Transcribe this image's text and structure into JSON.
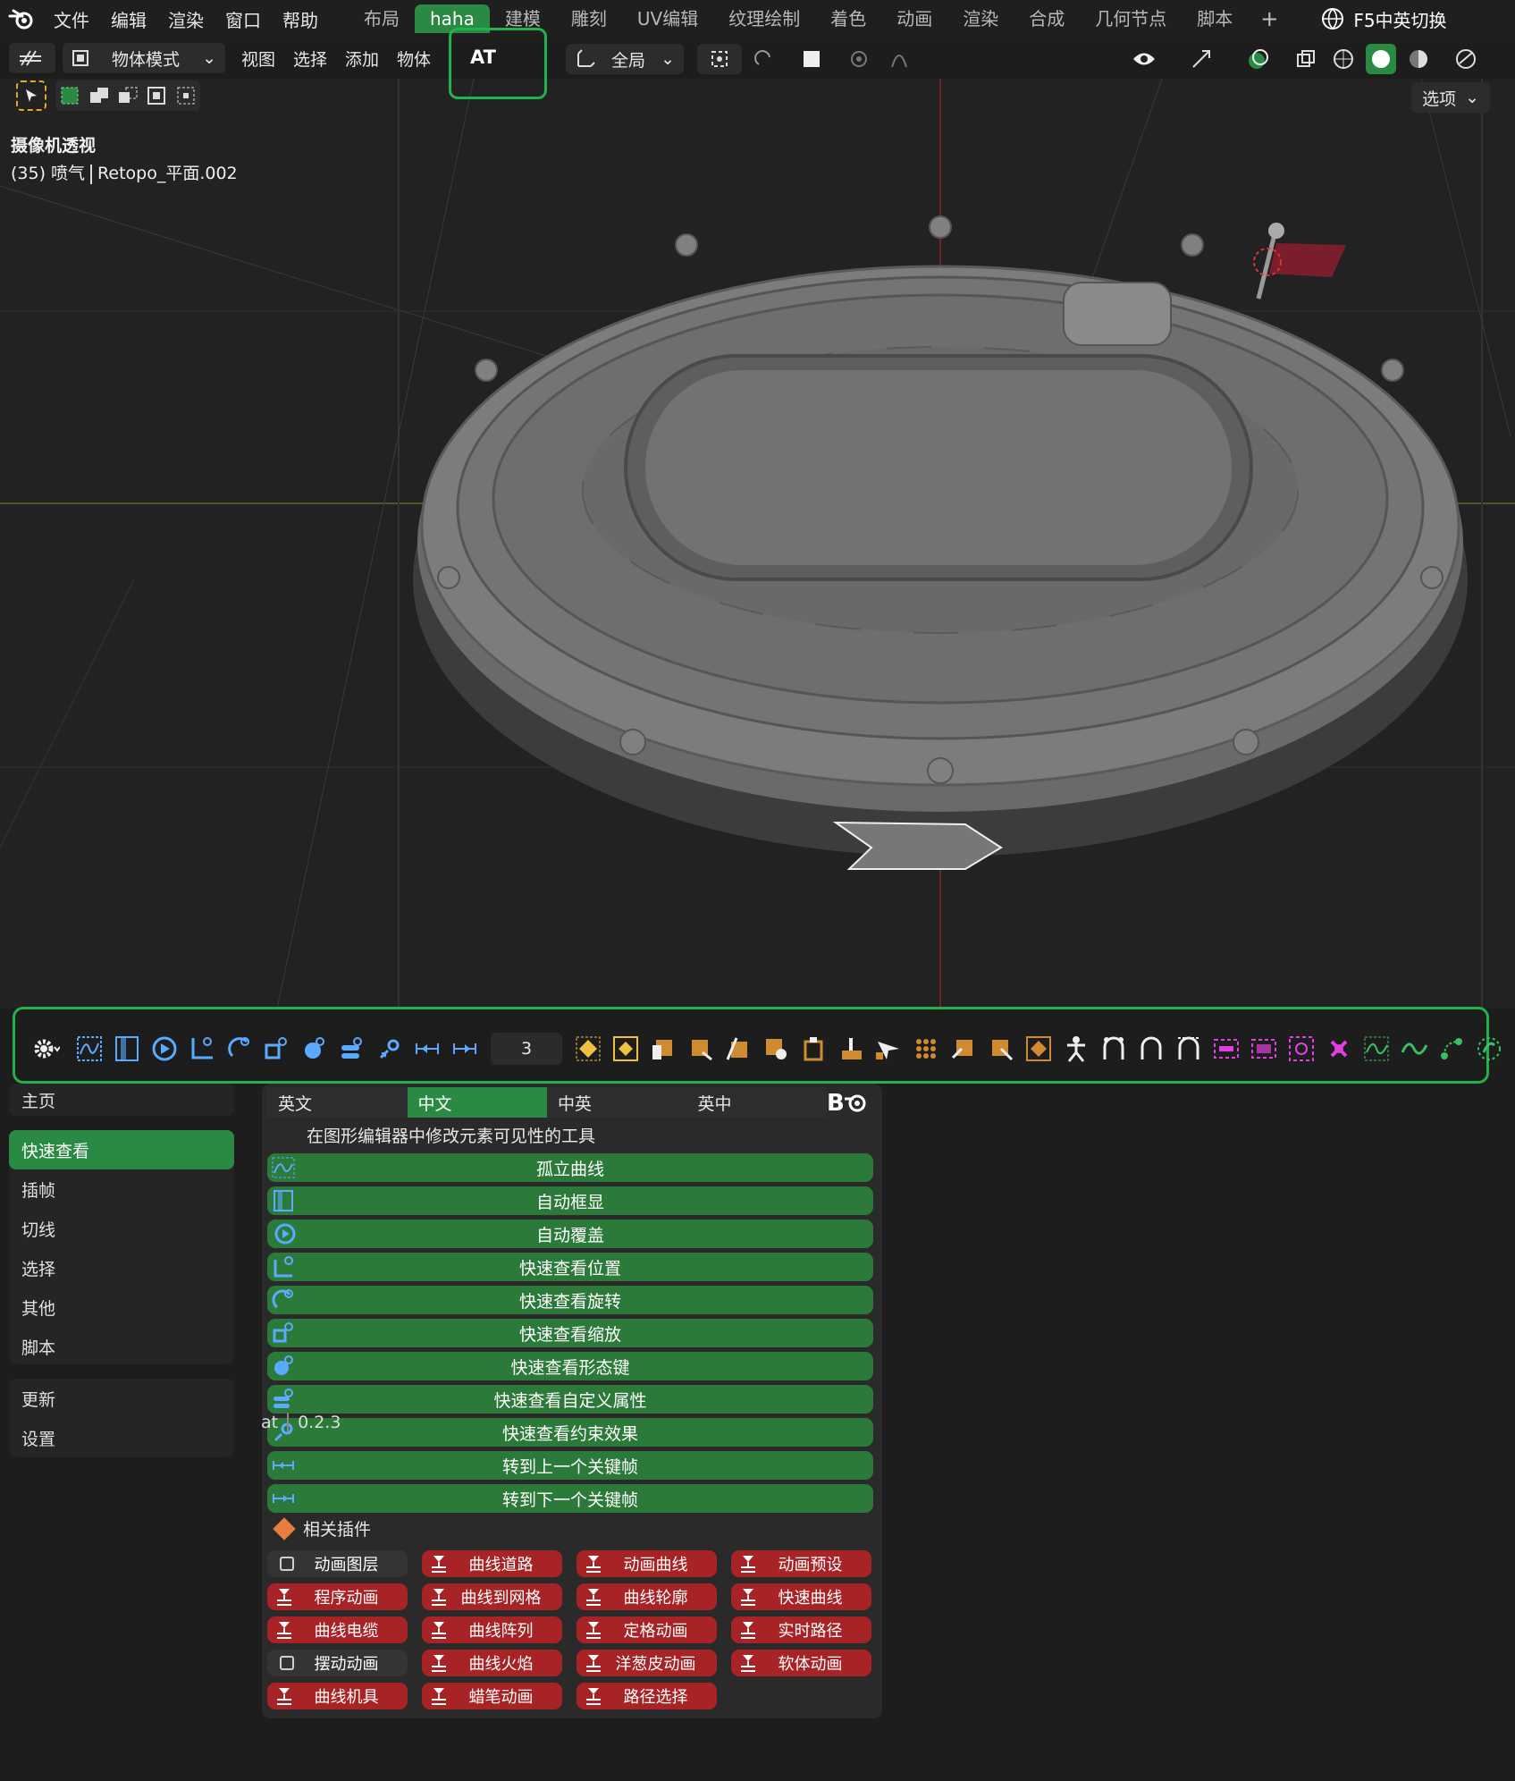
{
  "menubar": {
    "items": [
      "文件",
      "编辑",
      "渲染",
      "窗口",
      "帮助"
    ],
    "workspaces": [
      "布局",
      "haha",
      "建模",
      "雕刻",
      "UV编辑",
      "纹理绘制",
      "着色",
      "动画",
      "渲染",
      "合成",
      "几何节点",
      "脚本"
    ],
    "active_workspace": "haha",
    "lang_switch_label": "F5中英切换"
  },
  "header": {
    "mode": "物体模式",
    "menus": [
      "视图",
      "选择",
      "添加",
      "物体"
    ],
    "at_label": "AT",
    "transform_orientation": "全局",
    "options_label": "选项"
  },
  "viewport": {
    "title": "摄像机透视",
    "frame_info": "(35) 喷气",
    "object_name": "Retopo_平面.002"
  },
  "icon_strip": {
    "frame_value": "3"
  },
  "sidebar": {
    "top": [
      "主页"
    ],
    "main": [
      "快速查看",
      "插帧",
      "切线",
      "选择",
      "其他",
      "脚本"
    ],
    "active": "快速查看",
    "bottom": [
      "更新",
      "设置"
    ]
  },
  "panel": {
    "lang_tabs": [
      "英文",
      "中文",
      "中英",
      "英中"
    ],
    "active_lang": "中文",
    "description": "在图形编辑器中修改元素可见性的工具",
    "tools": [
      "孤立曲线",
      "自动框显",
      "自动覆盖",
      "快速查看位置",
      "快速查看旋转",
      "快速查看缩放",
      "快速查看形态键",
      "快速查看自定义属性",
      "快速查看约束效果",
      "转到上一个关键帧",
      "转到下一个关键帧"
    ],
    "related_title": "相关插件",
    "plugins": [
      {
        "label": "动画图层",
        "enabled": false
      },
      {
        "label": "曲线道路",
        "enabled": true
      },
      {
        "label": "动画曲线",
        "enabled": true
      },
      {
        "label": "动画预设",
        "enabled": true
      },
      {
        "label": "程序动画",
        "enabled": true
      },
      {
        "label": "曲线到网格",
        "enabled": true
      },
      {
        "label": "曲线轮廓",
        "enabled": true
      },
      {
        "label": "快速曲线",
        "enabled": true
      },
      {
        "label": "曲线电缆",
        "enabled": true
      },
      {
        "label": "曲线阵列",
        "enabled": true
      },
      {
        "label": "定格动画",
        "enabled": true
      },
      {
        "label": "实时路径",
        "enabled": true
      },
      {
        "label": "摆动动画",
        "enabled": false
      },
      {
        "label": "曲线火焰",
        "enabled": true
      },
      {
        "label": "洋葱皮动画",
        "enabled": true
      },
      {
        "label": "软体动画",
        "enabled": true
      },
      {
        "label": "曲线机具",
        "enabled": true
      },
      {
        "label": "蜡笔动画",
        "enabled": true
      },
      {
        "label": "路径选择",
        "enabled": true
      }
    ]
  },
  "footer": {
    "addon": "at",
    "version": "0.2.3"
  },
  "colors": {
    "accent_green": "#2a8a43",
    "tool_green": "#2c7a3a",
    "plugin_red": "#a82325",
    "highlight_border": "#23b14d"
  }
}
